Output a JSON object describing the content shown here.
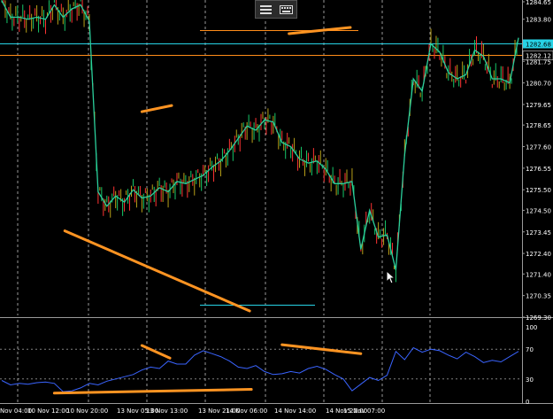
{
  "chart_data": {
    "type": "line",
    "price_axis": {
      "ticks": [
        "1284.65",
        "1283.80",
        "1281.75",
        "1280.70",
        "1279.65",
        "1278.65",
        "1277.60",
        "1276.55",
        "1275.50",
        "1274.50",
        "1273.45",
        "1272.40",
        "1271.40",
        "1270.35",
        "1269.30"
      ],
      "current_price_label": "1282.68",
      "level_label": "1282.12"
    },
    "indicator_axis": {
      "ticks": [
        "100",
        "70",
        "30",
        "0"
      ]
    },
    "time_labels": [
      "Nov 04:00",
      "10 Nov 12:00",
      "10 Nov 20:00",
      "13 Nov 05:00",
      "13 Nov 13:00",
      "13 Nov 21:00",
      "14 Nov 06:00",
      "14 Nov 14:00",
      "14 Nov 22:00",
      "15 Nov 07:00"
    ],
    "price_series": [
      1284.7,
      1283.9,
      1283.9,
      1283.8,
      1283.9,
      1283.8,
      1284.5,
      1283.9,
      1284.3,
      1284.5,
      1283.7,
      1275.4,
      1274.7,
      1275.2,
      1274.9,
      1275.5,
      1275.1,
      1275.2,
      1275.6,
      1275.4,
      1275.9,
      1275.8,
      1276.0,
      1276.2,
      1276.6,
      1276.9,
      1277.4,
      1278.0,
      1278.6,
      1278.4,
      1278.9,
      1278.8,
      1277.8,
      1277.6,
      1277.0,
      1276.8,
      1276.9,
      1276.5,
      1275.8,
      1275.8,
      1275.9,
      1272.6,
      1274.5,
      1273.2,
      1273.3,
      1271.6,
      1277.2,
      1280.9,
      1280.3,
      1282.6,
      1282.2,
      1281.2,
      1280.9,
      1281.1,
      1282.3,
      1282.0,
      1280.9,
      1280.9,
      1280.7,
      1282.9
    ],
    "indicator_series": [
      28,
      22,
      24,
      23,
      25,
      26,
      24,
      13,
      14,
      18,
      24,
      22,
      27,
      30,
      33,
      36,
      42,
      46,
      44,
      54,
      50,
      50,
      62,
      68,
      64,
      60,
      54,
      46,
      44,
      48,
      40,
      36,
      37,
      40,
      38,
      44,
      47,
      43,
      36,
      30,
      14,
      23,
      32,
      28,
      35,
      67,
      56,
      72,
      66,
      70,
      68,
      62,
      57,
      66,
      60,
      52,
      55,
      53,
      60,
      67
    ],
    "indicator_levels": [
      70,
      30
    ],
    "colors": {
      "background": "#000000",
      "price_line": "#2bcf9c",
      "candle_up": "#17c86a",
      "candle_down": "#ff3333",
      "candle_neutral": "#b8a018",
      "indicator_line": "#3a64ff",
      "trendline": "#ff9422",
      "current_price": "#27d3e6",
      "level_line": "#ff8c1a",
      "grid": "#d8d8d8",
      "axis_text": "#ffffff"
    }
  },
  "toolbar": {
    "icons": [
      "menu-lines-icon",
      "keyboard-icon"
    ]
  }
}
